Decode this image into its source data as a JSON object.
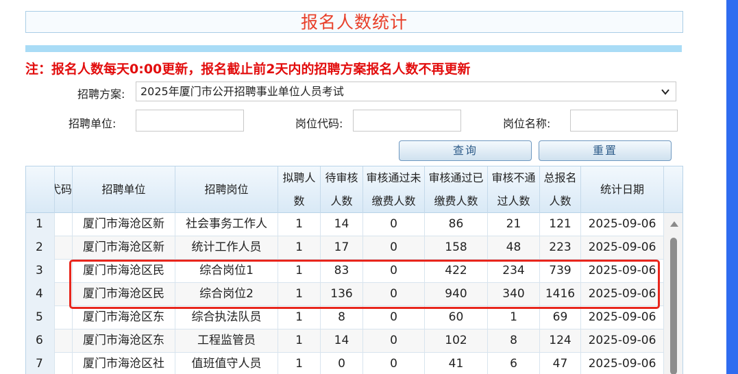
{
  "title": "报名人数统计",
  "notice": "注：报名人数每天0:00更新，报名截止前2天内的招聘方案报名人数不再更新",
  "filters": {
    "plan_label": "招聘方案:",
    "plan_value": "2025年厦门市公开招聘事业单位人员考试",
    "unit_label": "招聘单位:",
    "code_label": "岗位代码:",
    "name_label": "岗位名称:",
    "unit_value": "",
    "code_value": "",
    "name_value": ""
  },
  "buttons": {
    "query": "查询",
    "reset": "重置"
  },
  "table": {
    "headers": [
      "弋码",
      "招聘单位",
      "招聘岗位",
      "拟聘人数",
      "待审核人数",
      "审核通过未缴费人数",
      "审核通过已缴费人数",
      "审核不通过人数",
      "总报名人数",
      "统计日期"
    ],
    "rows": [
      {
        "no": "1",
        "code": "",
        "unit": "厦门市海沧区新",
        "post": "社会事务工作人",
        "plan": "1",
        "pending": "14",
        "unpaid": "0",
        "paid": "86",
        "rejected": "21",
        "total": "121",
        "date": "2025-09-06"
      },
      {
        "no": "2",
        "code": "",
        "unit": "厦门市海沧区新",
        "post": "统计工作人员",
        "plan": "1",
        "pending": "17",
        "unpaid": "0",
        "paid": "158",
        "rejected": "48",
        "total": "223",
        "date": "2025-09-06"
      },
      {
        "no": "3",
        "code": "",
        "unit": "厦门市海沧区民",
        "post": "综合岗位1",
        "plan": "1",
        "pending": "83",
        "unpaid": "0",
        "paid": "422",
        "rejected": "234",
        "total": "739",
        "date": "2025-09-06"
      },
      {
        "no": "4",
        "code": "",
        "unit": "厦门市海沧区民",
        "post": "综合岗位2",
        "plan": "1",
        "pending": "136",
        "unpaid": "0",
        "paid": "940",
        "rejected": "340",
        "total": "1416",
        "date": "2025-09-06"
      },
      {
        "no": "5",
        "code": "",
        "unit": "厦门市海沧区东",
        "post": "综合执法队员",
        "plan": "1",
        "pending": "8",
        "unpaid": "0",
        "paid": "60",
        "rejected": "1",
        "total": "69",
        "date": "2025-09-06"
      },
      {
        "no": "6",
        "code": "",
        "unit": "厦门市海沧区东",
        "post": "工程监管员",
        "plan": "1",
        "pending": "14",
        "unpaid": "0",
        "paid": "102",
        "rejected": "8",
        "total": "124",
        "date": "2025-09-06"
      },
      {
        "no": "7",
        "code": "",
        "unit": "厦门市海沧区社",
        "post": "值班值守人员",
        "plan": "1",
        "pending": "0",
        "unpaid": "0",
        "paid": "41",
        "rejected": "6",
        "total": "47",
        "date": "2025-09-06"
      }
    ]
  },
  "colors": {
    "title": "#e8402a",
    "notice": "#e20d0d",
    "highlight": "#e8261c",
    "header_bg": "#d9e9f6"
  }
}
